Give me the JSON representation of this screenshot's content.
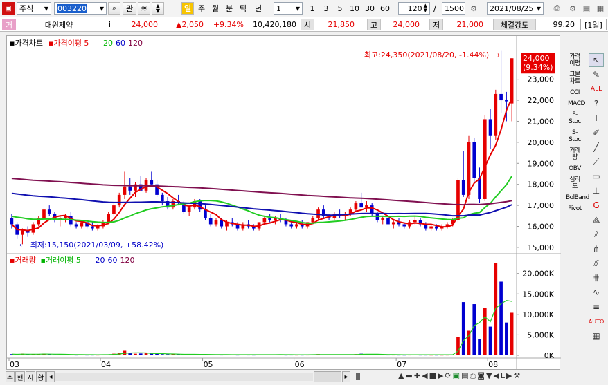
{
  "toolbar": {
    "market_type": "주식",
    "code": "003220",
    "search_icon": "search-icon",
    "btn_gwan": "관",
    "period_tabs": [
      "일",
      "주",
      "월",
      "분",
      "틱",
      "년"
    ],
    "interval_value": "1",
    "quick_intervals": [
      "1",
      "3",
      "5",
      "10",
      "30",
      "60"
    ],
    "count_value": "120",
    "total_value": "1500",
    "separator": "/",
    "date_value": "2021/08/25"
  },
  "quote": {
    "prefix_badge": "거",
    "name": "대원제약",
    "info_icon": "i",
    "price": "24,000",
    "change": "▲2,050",
    "change_pct": "+9.34%",
    "volume": "10,420,180",
    "open_label": "시",
    "open": "21,850",
    "high_label": "고",
    "high": "24,000",
    "low_label": "저",
    "low": "21,000",
    "strength_label": "체결강도",
    "strength": "99.20",
    "period_badge": "[1일]"
  },
  "price_panel": {
    "legend": [
      {
        "text": "가격차트",
        "color": "#000000"
      },
      {
        "text": "가격이평 5",
        "color": "#e60000"
      },
      {
        "text": "20",
        "color": "#00b400"
      },
      {
        "text": "60",
        "color": "#0000c8"
      },
      {
        "text": "120",
        "color": "#800040"
      }
    ],
    "max_annotation": "최고:24,350(2021/08/20, -1.44%)⟶",
    "min_annotation": "⟵최저:15,150(2021/03/09, +58.42%)",
    "current_price_tag": "24,000",
    "current_pct_tag": "(9.34%)",
    "y_ticks": [
      "23,000",
      "22,000",
      "21,000",
      "20,000",
      "19,000",
      "18,000",
      "17,000",
      "16,000",
      "15,000"
    ]
  },
  "volume_panel": {
    "legend": [
      {
        "text": "거래량",
        "color": "#e60000"
      },
      {
        "text": "거래이평 5",
        "color": "#00b400"
      },
      {
        "text": "20",
        "color": "#0000c8"
      },
      {
        "text": "60",
        "color": "#0000c8"
      },
      {
        "text": "120",
        "color": "#800040"
      }
    ],
    "y_ticks": [
      "20,000K",
      "15,000K",
      "10,000K",
      "5,000K",
      "0K"
    ]
  },
  "x_axis": [
    "03",
    "04",
    "05",
    "06",
    "07",
    "08"
  ],
  "indicators": [
    "가격이평",
    "그물차트",
    "CCI",
    "MACD",
    "F-Stoc",
    "S-Stoc",
    "거래량",
    "OBV",
    "심리도",
    "BolBand",
    "Pivot"
  ],
  "bottom_tabs": [
    "주",
    "현",
    "시",
    "황"
  ],
  "colors": {
    "up": "#e60000",
    "down": "#0000d0",
    "ma5": "#e60000",
    "ma20": "#22cc22",
    "ma60": "#1010b0",
    "ma120": "#801050"
  },
  "chart_data": {
    "type": "candlestick",
    "y_range": [
      14800,
      24600
    ],
    "volume_range_k": [
      0,
      24000
    ],
    "candles": [
      [
        16400,
        16600,
        15900,
        16100
      ],
      [
        16100,
        16200,
        15400,
        15600
      ],
      [
        15600,
        15900,
        15150,
        15800
      ],
      [
        15800,
        16000,
        15500,
        15700
      ],
      [
        15700,
        16200,
        15600,
        16100
      ],
      [
        16100,
        16500,
        16000,
        16400
      ],
      [
        16400,
        16900,
        16300,
        16800
      ],
      [
        16800,
        17000,
        16500,
        16600
      ],
      [
        16600,
        16700,
        16200,
        16300
      ],
      [
        16300,
        16500,
        16000,
        16400
      ],
      [
        16400,
        16600,
        16200,
        16500
      ],
      [
        16500,
        16700,
        16000,
        16100
      ],
      [
        16100,
        16200,
        15900,
        16000
      ],
      [
        16000,
        16300,
        15900,
        16200
      ],
      [
        16200,
        16300,
        15900,
        16000
      ],
      [
        16000,
        16200,
        15800,
        15900
      ],
      [
        15900,
        16100,
        15800,
        16000
      ],
      [
        16000,
        16300,
        15900,
        16200
      ],
      [
        16200,
        16700,
        16100,
        16600
      ],
      [
        16600,
        17100,
        16500,
        17000
      ],
      [
        17000,
        17600,
        16900,
        17500
      ],
      [
        17500,
        18600,
        17300,
        17900
      ],
      [
        17900,
        18300,
        17500,
        17700
      ],
      [
        17700,
        18100,
        17400,
        18000
      ],
      [
        18000,
        18400,
        17800,
        17700
      ],
      [
        17700,
        18300,
        17600,
        18200
      ],
      [
        18200,
        18600,
        17900,
        18000
      ],
      [
        18000,
        18200,
        17400,
        17500
      ],
      [
        17500,
        17600,
        17000,
        17200
      ],
      [
        17200,
        17400,
        16800,
        16900
      ],
      [
        16900,
        17300,
        16800,
        17200
      ],
      [
        17200,
        17500,
        17000,
        17100
      ],
      [
        17100,
        17200,
        16600,
        16700
      ],
      [
        16700,
        17000,
        16500,
        16900
      ],
      [
        16900,
        17300,
        16800,
        17200
      ],
      [
        17200,
        17300,
        16700,
        16800
      ],
      [
        16800,
        17000,
        16300,
        16400
      ],
      [
        16400,
        16600,
        16000,
        16100
      ],
      [
        16100,
        16400,
        16000,
        16300
      ],
      [
        16300,
        16400,
        15900,
        16000
      ],
      [
        16000,
        16300,
        15800,
        16200
      ],
      [
        16200,
        16400,
        16000,
        16100
      ],
      [
        16100,
        16200,
        15800,
        15900
      ],
      [
        15900,
        16200,
        15800,
        16100
      ],
      [
        16100,
        16300,
        15900,
        16000
      ],
      [
        16000,
        16100,
        15800,
        15900
      ],
      [
        15900,
        16200,
        15800,
        16200
      ],
      [
        16200,
        16500,
        16100,
        16400
      ],
      [
        16400,
        16600,
        16200,
        16300
      ],
      [
        16300,
        16500,
        16100,
        16400
      ],
      [
        16400,
        16600,
        16200,
        16300
      ],
      [
        16300,
        16400,
        16000,
        16100
      ],
      [
        16100,
        16300,
        15900,
        16000
      ],
      [
        16000,
        16200,
        15900,
        16100
      ],
      [
        16100,
        16300,
        15900,
        16000
      ],
      [
        16000,
        16200,
        15900,
        16200
      ],
      [
        16200,
        16500,
        16100,
        16400
      ],
      [
        16400,
        16900,
        16300,
        16800
      ],
      [
        16800,
        17000,
        16400,
        16500
      ],
      [
        16500,
        16600,
        16300,
        16400
      ],
      [
        16400,
        16700,
        16300,
        16600
      ],
      [
        16600,
        16800,
        16400,
        16500
      ],
      [
        16500,
        16700,
        16300,
        16600
      ],
      [
        16600,
        16900,
        16500,
        16800
      ],
      [
        16800,
        17200,
        16700,
        17100
      ],
      [
        17100,
        17600,
        16900,
        16900
      ],
      [
        16900,
        17200,
        16700,
        17000
      ],
      [
        17000,
        17100,
        16500,
        16600
      ],
      [
        16600,
        16700,
        16200,
        16300
      ],
      [
        16300,
        16500,
        16100,
        16400
      ],
      [
        16400,
        16500,
        16000,
        16100
      ],
      [
        16100,
        16300,
        15900,
        16200
      ],
      [
        16200,
        16400,
        16000,
        16100
      ],
      [
        16100,
        16200,
        15900,
        16000
      ],
      [
        16000,
        16300,
        15900,
        16200
      ],
      [
        16200,
        16500,
        16100,
        16300
      ],
      [
        16300,
        16400,
        16000,
        16100
      ],
      [
        16100,
        16200,
        15800,
        15900
      ],
      [
        15900,
        16100,
        15800,
        16000
      ],
      [
        16000,
        16100,
        15800,
        15900
      ],
      [
        15900,
        16100,
        15800,
        16000
      ],
      [
        16000,
        16200,
        15900,
        16100
      ],
      [
        16100,
        16400,
        16000,
        16300
      ],
      [
        16300,
        18300,
        16200,
        18200
      ],
      [
        18200,
        19600,
        17400,
        17500
      ],
      [
        17500,
        20300,
        17300,
        20000
      ],
      [
        20000,
        20200,
        18100,
        18300
      ],
      [
        18300,
        18800,
        17100,
        17300
      ],
      [
        17300,
        21300,
        17200,
        21100
      ],
      [
        21100,
        21600,
        19700,
        20300
      ],
      [
        20300,
        22500,
        20100,
        22300
      ],
      [
        22300,
        24350,
        21400,
        22000
      ],
      [
        22000,
        22400,
        21000,
        21950
      ],
      [
        21850,
        24000,
        21000,
        24000
      ]
    ],
    "volumes_k": [
      300,
      200,
      400,
      250,
      300,
      250,
      400,
      300,
      200,
      200,
      200,
      180,
      150,
      200,
      150,
      150,
      150,
      200,
      250,
      400,
      600,
      1100,
      500,
      400,
      450,
      500,
      450,
      400,
      300,
      250,
      300,
      250,
      200,
      250,
      300,
      200,
      200,
      180,
      170,
      160,
      180,
      170,
      150,
      180,
      160,
      150,
      180,
      200,
      170,
      170,
      170,
      150,
      160,
      150,
      150,
      160,
      200,
      300,
      200,
      170,
      180,
      170,
      170,
      200,
      300,
      400,
      250,
      220,
      180,
      170,
      160,
      160,
      150,
      140,
      160,
      170,
      150,
      150,
      140,
      140,
      140,
      150,
      180,
      4500,
      13000,
      6000,
      12500,
      4000,
      11500,
      7000,
      22500,
      18000,
      8000,
      10400
    ],
    "series": [
      {
        "name": "가격이평 5",
        "type": "ma",
        "period": 5
      },
      {
        "name": "20",
        "type": "ma",
        "period": 20
      },
      {
        "name": "60",
        "type": "ma",
        "period": 60
      },
      {
        "name": "120",
        "type": "ma",
        "period": 120
      }
    ]
  }
}
